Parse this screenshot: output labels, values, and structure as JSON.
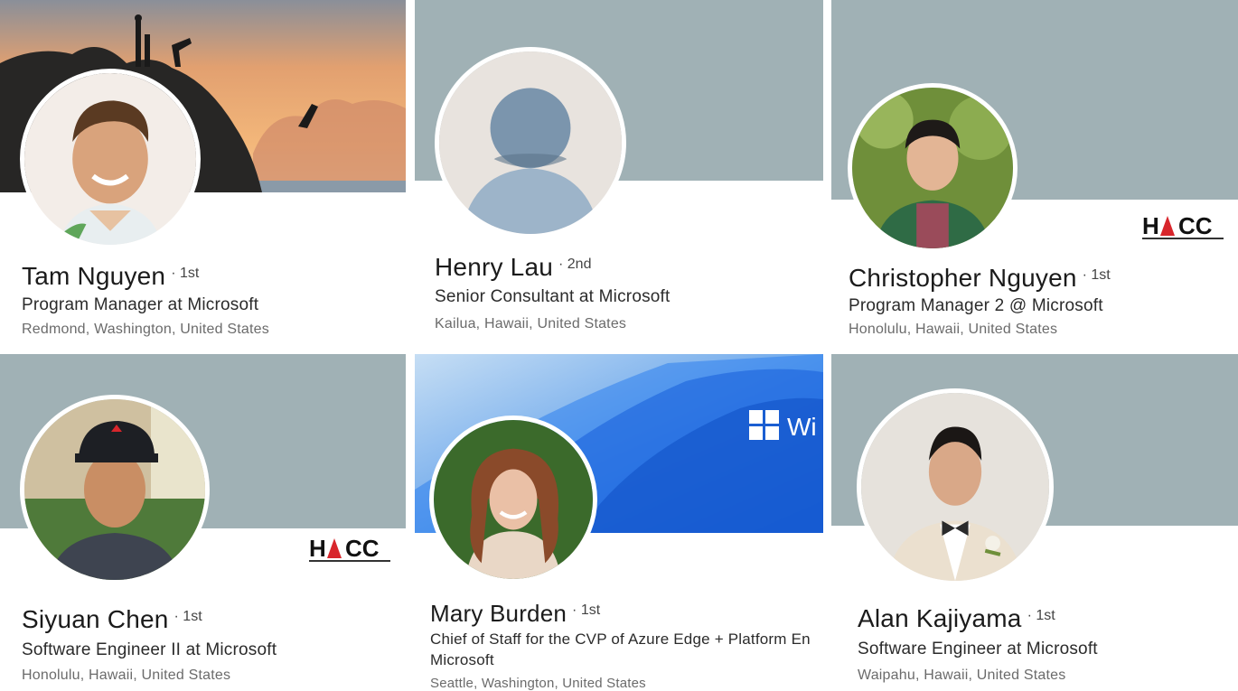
{
  "colors": {
    "gray_banner": "#a0b1b5",
    "hacc_red": "#d8262c",
    "windows_blue": "#1e6fe8"
  },
  "profiles": [
    {
      "name": "Tam Nguyen",
      "degree": "· 1st",
      "headline": "Program Manager at Microsoft",
      "location": "Redmond, Washington, United States",
      "banner": "sunset-cliff-photo"
    },
    {
      "name": "Henry Lau",
      "degree": "· 2nd",
      "headline": "Senior Consultant at Microsoft",
      "location": "Kailua, Hawaii, United States",
      "banner": "gray"
    },
    {
      "name": "Christopher Nguyen",
      "degree": "· 1st",
      "headline": "Program Manager 2 @ Microsoft",
      "location": "Honolulu, Hawaii, United States",
      "banner": "gray",
      "logo": "HACC"
    },
    {
      "name": "Siyuan Chen",
      "degree": "· 1st",
      "headline": "Software Engineer II at Microsoft",
      "location": "Honolulu, Hawaii, United States",
      "banner": "gray",
      "logo": "HACC"
    },
    {
      "name": "Mary Burden",
      "degree": "· 1st",
      "headline": "Chief of Staff for the CVP of Azure Edge + Platform En",
      "headline_line2": "Microsoft",
      "location": "Seattle, Washington, United States",
      "banner": "windows-bloom",
      "banner_text": "Wi"
    },
    {
      "name": "Alan Kajiyama",
      "degree": "· 1st",
      "headline": "Software Engineer at Microsoft",
      "location": "Waipahu, Hawaii, United States",
      "banner": "gray"
    }
  ]
}
